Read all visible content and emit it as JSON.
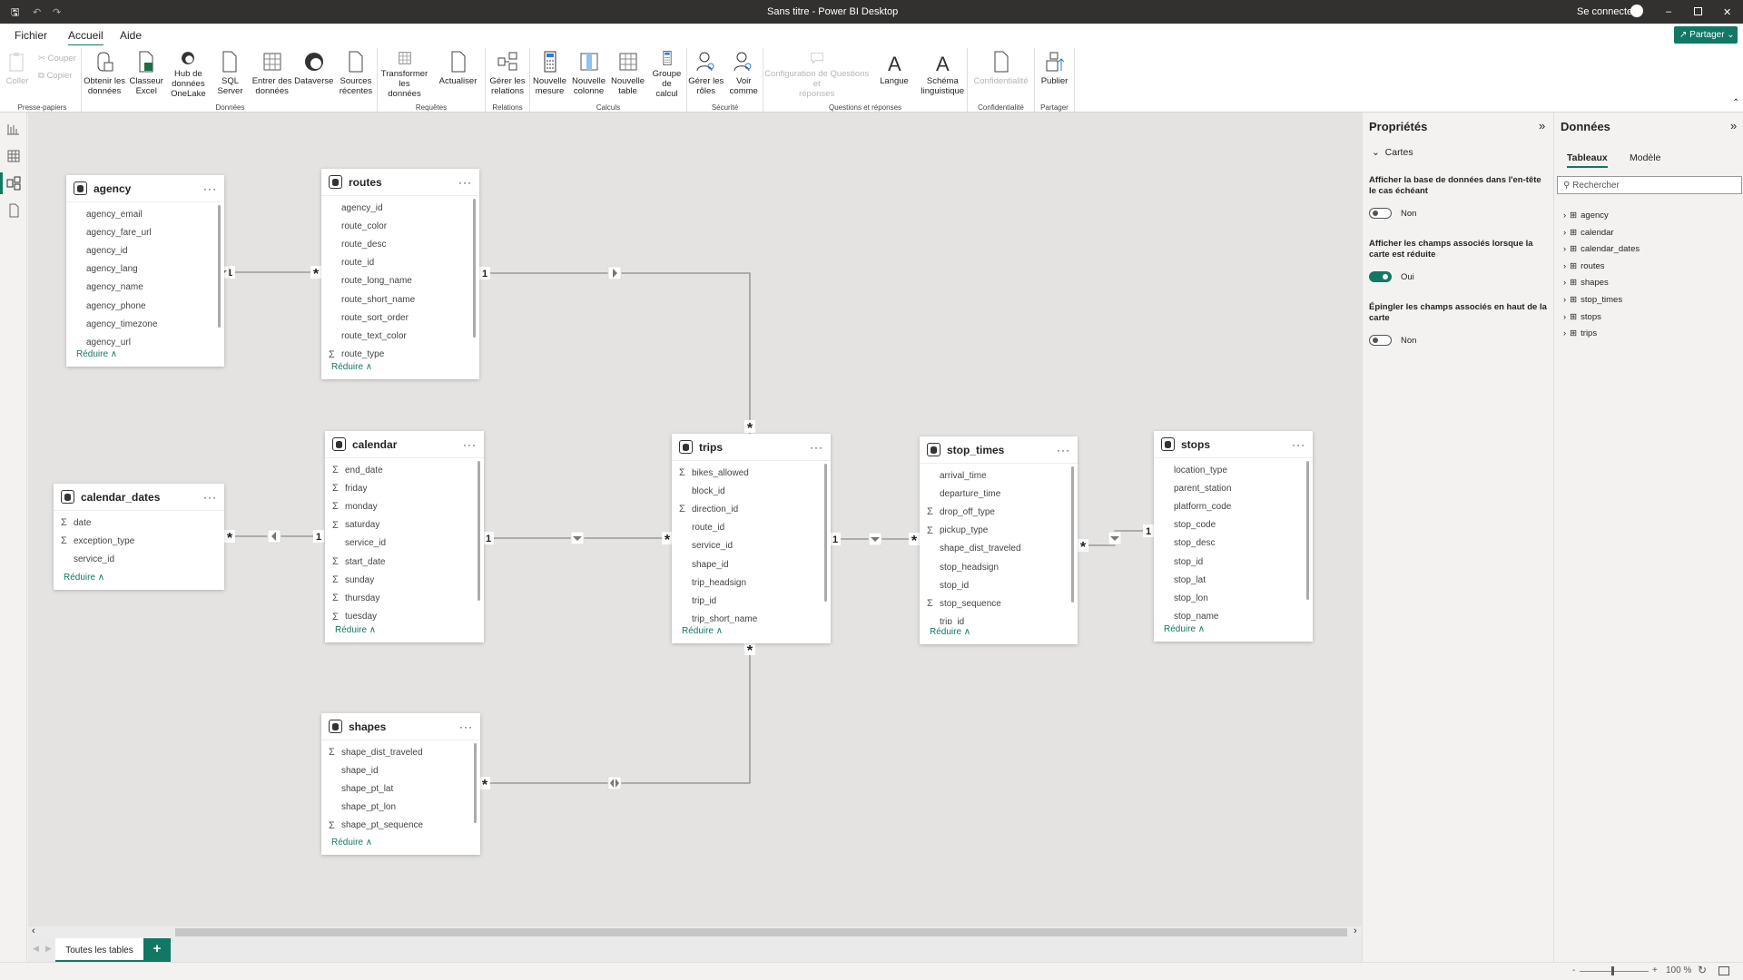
{
  "titlebar": {
    "title": "Sans titre - Power BI Desktop",
    "sign_in": "Se connecter"
  },
  "menu": {
    "file": "Fichier",
    "home": "Accueil",
    "help": "Aide"
  },
  "share_button": "Partager",
  "ribbon": {
    "clipboard": {
      "label": "Presse-papiers",
      "paste": "Coller",
      "cut": "Couper",
      "copy": "Copier"
    },
    "data": {
      "label": "Données",
      "get_data": [
        "Obtenir les",
        "données"
      ],
      "excel": [
        "Classeur",
        "Excel"
      ],
      "onelake": [
        "Hub de données",
        "OneLake"
      ],
      "sql": [
        "SQL",
        "Server"
      ],
      "enter": [
        "Entrer des",
        "données"
      ],
      "dataverse": [
        "Dataverse",
        ""
      ],
      "recent": [
        "Sources",
        "récentes"
      ]
    },
    "queries": {
      "label": "Requêtes",
      "transform": [
        "Transformer les",
        "données"
      ],
      "refresh": [
        "Actualiser",
        ""
      ]
    },
    "relations": {
      "label": "Relations",
      "manage": [
        "Gérer les",
        "relations"
      ]
    },
    "calculations": {
      "label": "Calculs",
      "measure": [
        "Nouvelle",
        "mesure"
      ],
      "column": [
        "Nouvelle",
        "colonne"
      ],
      "table": [
        "Nouvelle",
        "table"
      ],
      "group": [
        "Groupe de",
        "calcul"
      ]
    },
    "security": {
      "label": "Sécurité",
      "roles": [
        "Gérer les",
        "rôles"
      ],
      "view_as": [
        "Voir",
        "comme"
      ]
    },
    "qa": {
      "label": "Questions et réponses",
      "setup": [
        "Configuration de Questions et",
        "réponses"
      ],
      "language": [
        "Langue",
        ""
      ],
      "schema": [
        "Schéma",
        "linguistique"
      ]
    },
    "sensitivity": {
      "label": "Confidentialité",
      "button": [
        "Confidentialité",
        ""
      ]
    },
    "share": {
      "label": "Partager",
      "publish": [
        "Publier",
        ""
      ]
    }
  },
  "tables": [
    {
      "name": "agency",
      "fields": [
        {
          "n": "agency_email"
        },
        {
          "n": "agency_fare_url"
        },
        {
          "n": "agency_id"
        },
        {
          "n": "agency_lang"
        },
        {
          "n": "agency_name"
        },
        {
          "n": "agency_phone"
        },
        {
          "n": "agency_timezone"
        },
        {
          "n": "agency_url"
        }
      ]
    },
    {
      "name": "routes",
      "fields": [
        {
          "n": "agency_id"
        },
        {
          "n": "route_color"
        },
        {
          "n": "route_desc"
        },
        {
          "n": "route_id"
        },
        {
          "n": "route_long_name"
        },
        {
          "n": "route_short_name"
        },
        {
          "n": "route_sort_order"
        },
        {
          "n": "route_text_color"
        },
        {
          "n": "route_type",
          "s": true
        }
      ]
    },
    {
      "name": "calendar_dates",
      "fields": [
        {
          "n": "date",
          "s": true
        },
        {
          "n": "exception_type",
          "s": true
        },
        {
          "n": "service_id"
        }
      ]
    },
    {
      "name": "calendar",
      "fields": [
        {
          "n": "end_date",
          "s": true
        },
        {
          "n": "friday",
          "s": true
        },
        {
          "n": "monday",
          "s": true
        },
        {
          "n": "saturday",
          "s": true
        },
        {
          "n": "service_id"
        },
        {
          "n": "start_date",
          "s": true
        },
        {
          "n": "sunday",
          "s": true
        },
        {
          "n": "thursday",
          "s": true
        },
        {
          "n": "tuesday",
          "s": true
        }
      ]
    },
    {
      "name": "trips",
      "fields": [
        {
          "n": "bikes_allowed",
          "s": true
        },
        {
          "n": "block_id"
        },
        {
          "n": "direction_id",
          "s": true
        },
        {
          "n": "route_id"
        },
        {
          "n": "service_id"
        },
        {
          "n": "shape_id"
        },
        {
          "n": "trip_headsign"
        },
        {
          "n": "trip_id"
        },
        {
          "n": "trip_short_name"
        }
      ]
    },
    {
      "name": "stop_times",
      "fields": [
        {
          "n": "arrival_time"
        },
        {
          "n": "departure_time"
        },
        {
          "n": "drop_off_type",
          "s": true
        },
        {
          "n": "pickup_type",
          "s": true
        },
        {
          "n": "shape_dist_traveled"
        },
        {
          "n": "stop_headsign"
        },
        {
          "n": "stop_id"
        },
        {
          "n": "stop_sequence",
          "s": true
        },
        {
          "n": "trip_id"
        }
      ]
    },
    {
      "name": "stops",
      "fields": [
        {
          "n": "location_type"
        },
        {
          "n": "parent_station"
        },
        {
          "n": "platform_code"
        },
        {
          "n": "stop_code"
        },
        {
          "n": "stop_desc"
        },
        {
          "n": "stop_id"
        },
        {
          "n": "stop_lat"
        },
        {
          "n": "stop_lon"
        },
        {
          "n": "stop_name"
        }
      ]
    },
    {
      "name": "shapes",
      "fields": [
        {
          "n": "shape_dist_traveled",
          "s": true
        },
        {
          "n": "shape_id"
        },
        {
          "n": "shape_pt_lat"
        },
        {
          "n": "shape_pt_lon"
        },
        {
          "n": "shape_pt_sequence",
          "s": true
        }
      ]
    }
  ],
  "collapse_label": "Réduire",
  "relationships": [
    {
      "from": "agency",
      "to": "routes",
      "from_card": "1",
      "to_card": "*",
      "direction": "single"
    },
    {
      "from": "routes",
      "to": "trips",
      "from_card": "1",
      "to_card": "*",
      "direction": "single"
    },
    {
      "from": "calendar",
      "to": "calendar_dates",
      "from_card": "1",
      "to_card": "*",
      "direction": "single"
    },
    {
      "from": "calendar",
      "to": "trips",
      "from_card": "1",
      "to_card": "*",
      "direction": "single"
    },
    {
      "from": "trips",
      "to": "stop_times",
      "from_card": "1",
      "to_card": "*",
      "direction": "single"
    },
    {
      "from": "stops",
      "to": "stop_times",
      "from_card": "1",
      "to_card": "*",
      "direction": "single"
    },
    {
      "from": "trips",
      "to": "shapes",
      "from_card": "*",
      "to_card": "*",
      "direction": "both"
    }
  ],
  "bottom": {
    "tab": "Toutes les tables",
    "add": "+"
  },
  "status": {
    "zoom": "100 %",
    "zoom_level": 100
  },
  "properties": {
    "title": "Propriétés",
    "section": "Cartes",
    "options": [
      {
        "label": "Afficher la base de données dans l'en-tête le cas échéant",
        "value": "Non",
        "on": false
      },
      {
        "label": "Afficher les champs associés lorsque la carte est réduite",
        "value": "Oui",
        "on": true
      },
      {
        "label": "Épingler les champs associés en haut de la carte",
        "value": "Non",
        "on": false
      }
    ]
  },
  "data_pane": {
    "title": "Données",
    "tabs": [
      "Tableaux",
      "Modèle"
    ],
    "search_placeholder": "Rechercher",
    "items": [
      "agency",
      "calendar",
      "calendar_dates",
      "routes",
      "shapes",
      "stop_times",
      "stops",
      "trips"
    ]
  },
  "colors": {
    "accent": "#117865",
    "titlebar": "#323130",
    "canvas": "#e4e3e1"
  }
}
